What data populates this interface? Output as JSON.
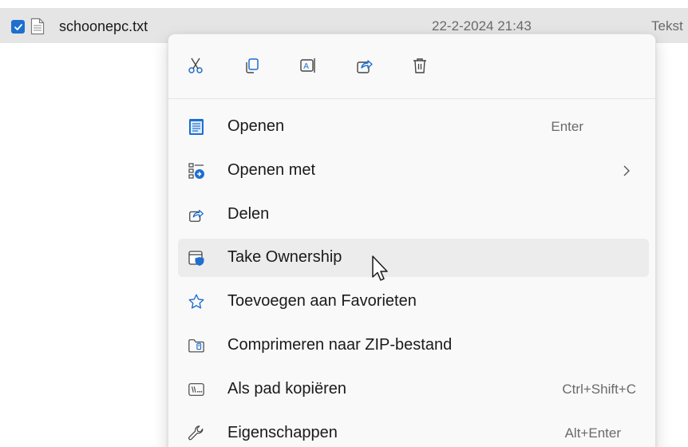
{
  "file": {
    "name": "schoonepc.txt",
    "date": "22-2-2024 21:43",
    "type": "Tekst"
  },
  "quick_actions": [
    {
      "icon": "cut-icon"
    },
    {
      "icon": "copy-icon"
    },
    {
      "icon": "rename-icon"
    },
    {
      "icon": "share-icon"
    },
    {
      "icon": "delete-icon"
    }
  ],
  "menu": {
    "items": [
      {
        "label": "Openen",
        "shortcut": "Enter",
        "icon": "notepad-icon"
      },
      {
        "label": "Openen met",
        "shortcut": "",
        "icon": "open-with-icon"
      },
      {
        "label": "Delen",
        "shortcut": "",
        "icon": "share-icon"
      },
      {
        "label": "Take Ownership",
        "shortcut": "",
        "icon": "shield-window-icon"
      },
      {
        "label": "Toevoegen aan Favorieten",
        "shortcut": "",
        "icon": "star-icon"
      },
      {
        "label": "Comprimeren naar ZIP-bestand",
        "shortcut": "",
        "icon": "zip-folder-icon"
      },
      {
        "label": "Als pad kopiëren",
        "shortcut": "Ctrl+Shift+C",
        "icon": "copy-path-icon"
      },
      {
        "label": "Eigenschappen",
        "shortcut": "Alt+Enter",
        "icon": "wrench-icon"
      }
    ]
  },
  "colors": {
    "accent": "#1e6fcf",
    "selected_row": "#e5e5e5",
    "menu_bg": "#f9f9f9",
    "hover": "#ececec"
  }
}
